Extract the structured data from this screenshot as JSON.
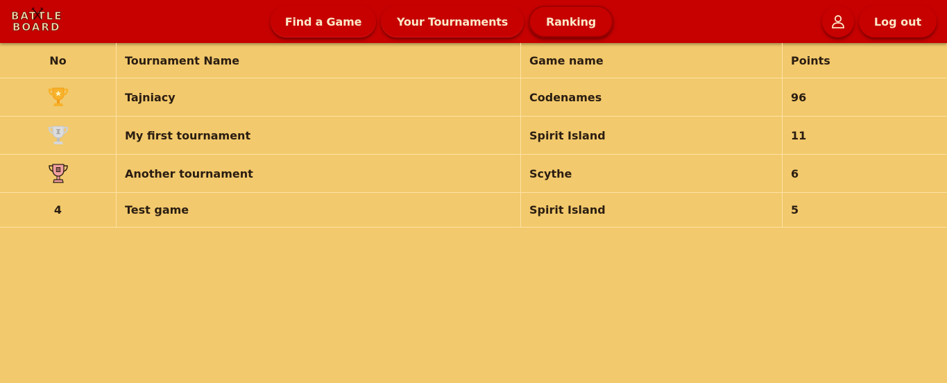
{
  "app": {
    "logo": {
      "line1": "BATTLE",
      "line2": "BOARD"
    }
  },
  "nav": {
    "find_game": "Find a Game",
    "your_tournaments": "Your Tournaments",
    "ranking": "Ranking",
    "logout": "Log out"
  },
  "table": {
    "headers": {
      "no": "No",
      "tournament": "Tournament Name",
      "game": "Game name",
      "points": "Points"
    },
    "rows": [
      {
        "rank_icon": "gold-trophy-icon",
        "tournament": "Tajniacy",
        "game": "Codenames",
        "points": "96"
      },
      {
        "rank_icon": "silver-trophy-icon",
        "tournament": "My first tournament",
        "game": "Spirit Island",
        "points": "11"
      },
      {
        "rank_icon": "bronze-trophy-icon",
        "tournament": "Another tournament",
        "game": "Scythe",
        "points": "6"
      },
      {
        "rank": "4",
        "tournament": "Test game",
        "game": "Spirit Island",
        "points": "5"
      }
    ]
  },
  "colors": {
    "header_red": "#c70000",
    "page_bg": "#f2c96c",
    "text": "#2a1d12",
    "button_text": "#fbe8c8"
  }
}
